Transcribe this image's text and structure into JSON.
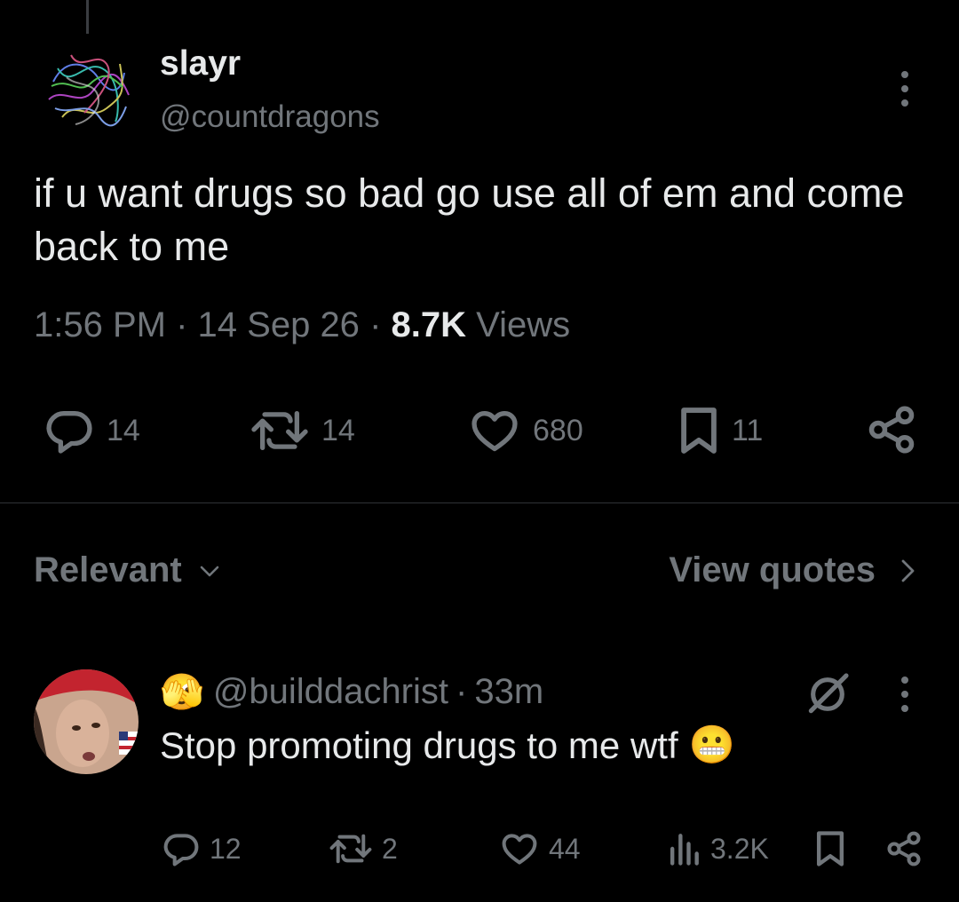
{
  "tweet": {
    "display_name": "slayr",
    "handle": "@countdragons",
    "text": "if u want drugs so bad go use all of em and come back to me",
    "time": "1:56 PM",
    "date": "14 Sep 26",
    "views_count": "8.7K",
    "views_label": "Views",
    "sep": "·",
    "actions": {
      "replies": "14",
      "reposts": "14",
      "likes": "680",
      "bookmarks": "11"
    }
  },
  "filter": {
    "sort_label": "Relevant",
    "view_quotes_label": "View quotes"
  },
  "reply": {
    "emoji": "🫣",
    "handle": "@builddachrist",
    "sep": "·",
    "time": "33m",
    "text": "Stop promoting drugs to me wtf",
    "text_emoji": "😬",
    "actions": {
      "replies": "12",
      "reposts": "2",
      "likes": "44",
      "views": "3.2K"
    }
  },
  "colors": {
    "background": "#000000",
    "primary_text": "#e7e9ea",
    "secondary_text": "#71767b",
    "divider": "#2f3336"
  }
}
